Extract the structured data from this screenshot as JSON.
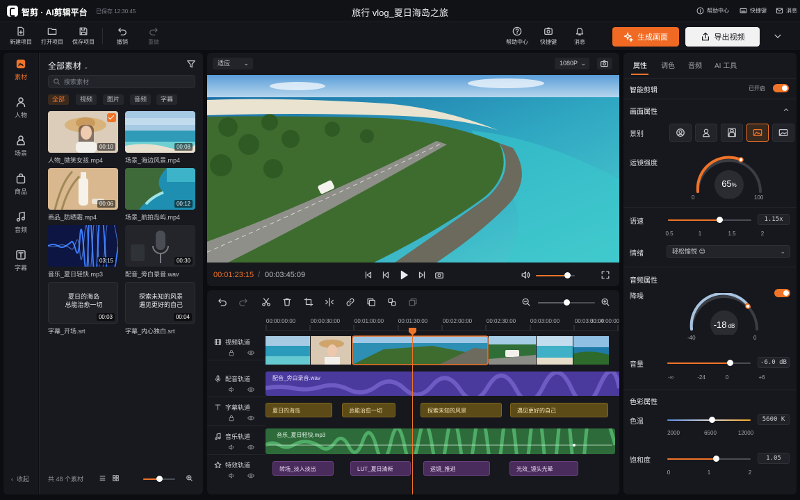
{
  "app": {
    "name": "智剪 · AI剪辑平台",
    "autosave": "已保存 12:30:45",
    "project_title": "旅行 vlog_夏日海岛之旅"
  },
  "top_links": {
    "help": "帮助中心",
    "shortcuts": "快捷键",
    "messages": "消息"
  },
  "toolbar": {
    "new": "新建项目",
    "open": "打开项目",
    "save": "保存项目",
    "undo": "撤销",
    "redo": "重做",
    "help": "帮助中心",
    "shortcuts": "快捷键",
    "messages": "消息",
    "generate": "生成画面",
    "export": "导出视频"
  },
  "nav": {
    "items": [
      "素材",
      "人物",
      "场景",
      "商品",
      "音频",
      "字幕"
    ],
    "active": "素材",
    "collapse": "收起"
  },
  "library": {
    "title": "全部素材",
    "search_placeholder": "搜索素材",
    "filters": [
      "全部",
      "视频",
      "图片",
      "音频",
      "字幕"
    ],
    "active_filter": "全部",
    "assets": [
      {
        "name": "人物_微笑女孩.mp4",
        "duration": "00:10",
        "selected": true
      },
      {
        "name": "场景_海边风景.mp4",
        "duration": "00:08"
      },
      {
        "name": "商品_防晒霜.mp4",
        "duration": "00:06"
      },
      {
        "name": "场景_航拍岛屿.mp4",
        "duration": "00:12"
      },
      {
        "name": "音乐_夏日轻快.mp3",
        "duration": "03:15"
      },
      {
        "name": "配音_旁白录音.wav",
        "duration": "00:30"
      },
      {
        "name": "字幕_开场.srt",
        "duration": "00:03",
        "text": "夏日的海岛\n总能治愈一切"
      },
      {
        "name": "字幕_内心独白.srt",
        "duration": "00:04",
        "text": "探索未知的风景\n遇见更好的自己"
      }
    ],
    "count": "共 48 个素材",
    "zoom_fraction": 0.5
  },
  "player": {
    "fit": "适应",
    "resolution": "1080P",
    "current_time": "00:01:23:15",
    "separator": "/",
    "total_time": "00:03:45:09",
    "volume_fraction": 0.8
  },
  "timeline": {
    "ruler": [
      "00:00:00:00",
      "00:00:30:00",
      "00:01:00:00",
      "00:01:30:00",
      "00:02:00:00",
      "00:02:30:00",
      "00:03:00:00",
      "00:03:30:00",
      "00:04:00:00"
    ],
    "tracks": [
      "视频轨道",
      "配音轨道",
      "字幕轨道",
      "音乐轨道",
      "特效轨道"
    ],
    "voice_clip": "配音_旁白录音.wav",
    "music_clip": "音乐_夏日轻快.mp3",
    "subtitles": [
      "夏日的海岛",
      "总能治愈一切",
      "探索未知的风景",
      "遇见更好的自己"
    ],
    "effects": [
      "转场_淡入淡出",
      "LUT_夏日清新",
      "运镜_推进",
      "光效_镜头光晕"
    ],
    "zoom_fraction": 0.5
  },
  "props": {
    "tabs": [
      "属性",
      "调色",
      "音频",
      "AI 工具"
    ],
    "active_tab": "属性",
    "smart_edit": "智能剪辑",
    "smart_edit_state": "已开启",
    "frame_section": "画面属性",
    "shot_label": "景别",
    "shot_selected_index": 3,
    "motion_label": "运镜强度",
    "motion_value": "65",
    "motion_unit": "%",
    "motion_min": "0",
    "motion_max": "100",
    "speed_label": "语速",
    "speed_value": "1.15x",
    "speed_ticks": [
      "0.5",
      "1",
      "1.5",
      "2"
    ],
    "speed_fraction": 0.62,
    "mood_label": "情绪",
    "mood_value": "轻松愉悦 😊",
    "audio_section": "音频属性",
    "denoise_label": "降噪",
    "denoise_value": "-18",
    "denoise_unit": "dB",
    "denoise_min": "-40",
    "denoise_max": "0",
    "volume_label": "音量",
    "volume_value": "-6.0 dB",
    "volume_ticks": [
      "-∞",
      "-24",
      "0",
      "+6"
    ],
    "volume_fraction": 0.75,
    "color_section": "色彩属性",
    "temp_label": "色温",
    "temp_value": "5600 K",
    "temp_ticks": [
      "2000",
      "6500",
      "12000"
    ],
    "temp_fraction": 0.53,
    "sat_label": "饱和度",
    "sat_value": "1.05",
    "sat_ticks": [
      "0",
      "1",
      "2"
    ],
    "sat_fraction": 0.58
  },
  "colors": {
    "accent": "#f07328",
    "voice": "#4b3a9e",
    "music": "#2e6b3a"
  }
}
